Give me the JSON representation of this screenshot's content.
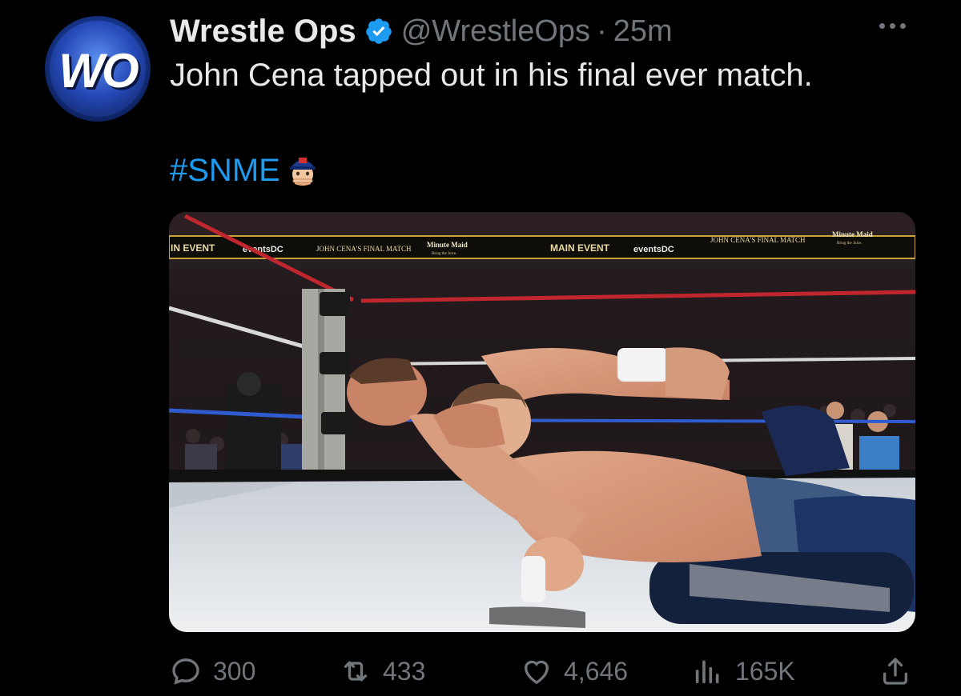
{
  "author": {
    "display_name": "Wrestle Ops",
    "handle": "@WrestleOps",
    "separator": "·",
    "time": "25m",
    "avatar_text": "WO",
    "verified": true
  },
  "tweet": {
    "text": "John Cena tapped out in his final ever match.",
    "hashtag": "#SNME"
  },
  "media": {
    "banner_texts": [
      "IN EVENT",
      "eventsDC",
      "JOHN CENA'S FINAL MATCH",
      "Minute Maid",
      "Bring the Juice.",
      "MAIN EVENT",
      "eventsDC",
      "JOHN CENA'S FINAL MATCH",
      "Minute Maid",
      "Bring the Juice."
    ]
  },
  "actions": {
    "replies": "300",
    "reposts": "433",
    "likes": "4,646",
    "views": "165K"
  },
  "colors": {
    "background": "#000000",
    "text_primary": "#e7e9ea",
    "text_secondary": "#71767b",
    "link": "#1d9bf0"
  },
  "icons": [
    "verified-badge-icon",
    "more-icon",
    "reply-icon",
    "repost-icon",
    "like-icon",
    "views-icon",
    "share-icon"
  ]
}
